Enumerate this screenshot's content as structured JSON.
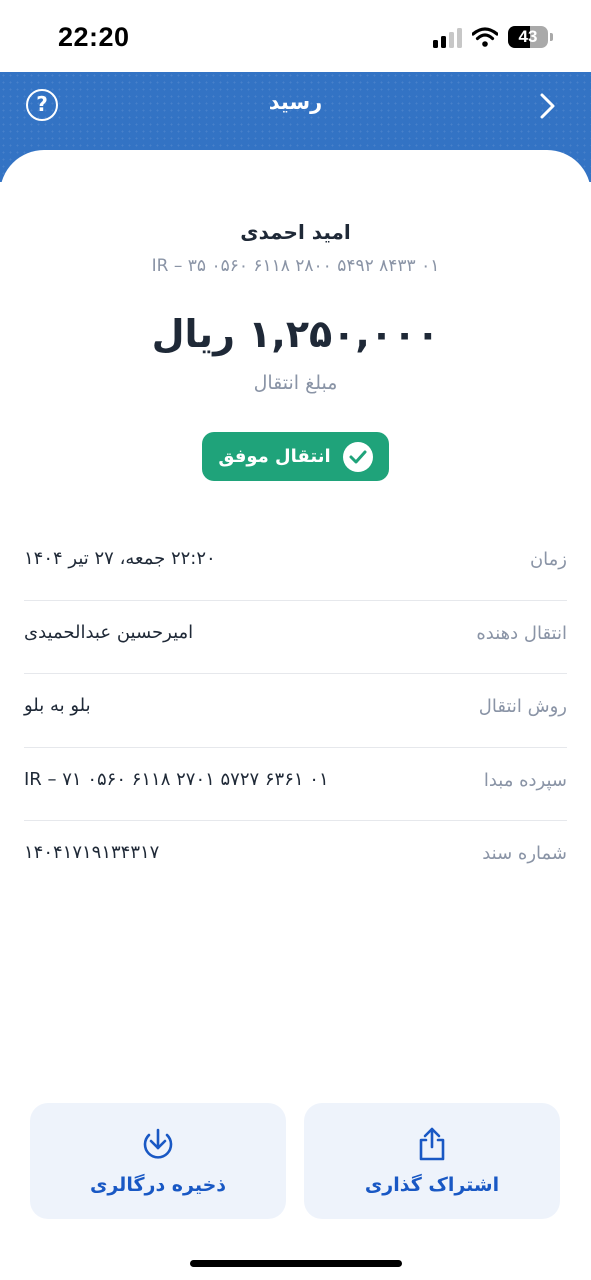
{
  "status_bar": {
    "time": "22:20",
    "battery": "43",
    "icons": [
      "cellular-signal-icon",
      "wifi-icon",
      "battery-icon"
    ]
  },
  "header": {
    "title": "رسید",
    "help_icon": "?",
    "icons": [
      "help-icon",
      "back-chevron-icon"
    ],
    "color": "#3373c4"
  },
  "recipient": {
    "name": "امید احمدی",
    "iban": "IR – ۳۵ ۰۵۶۰ ۶۱۱۸ ۲۸۰۰ ۵۴۹۲ ۸۴۳۳ ۰۱"
  },
  "amount": {
    "value": "۱,۲۵۰,۰۰۰ ریال",
    "label": "مبلغ انتقال"
  },
  "status": {
    "label": "انتقال موفق",
    "color": "#1fa37a"
  },
  "details": [
    {
      "label": "زمان",
      "value": "۲۲:۲۰ جمعه، ۲۷ تیر ۱۴۰۴"
    },
    {
      "label": "انتقال دهنده",
      "value": "امیرحسین عبدالحمیدی"
    },
    {
      "label": "روش انتقال",
      "value": "بلو به بلو"
    },
    {
      "label": "سپرده مبدا",
      "value": "IR – ۷۱ ۰۵۶۰ ۶۱۱۸ ۲۷۰۱ ۵۷۲۷ ۶۳۶۱ ۰۱"
    },
    {
      "label": "شماره سند",
      "value": "۱۴۰۴۱۷۱۹۱۳۴۳۱۷"
    }
  ],
  "actions": {
    "save_label": "ذخیره درگالری",
    "share_label": "اشتراک گذاری",
    "accent": "#1958c4"
  }
}
